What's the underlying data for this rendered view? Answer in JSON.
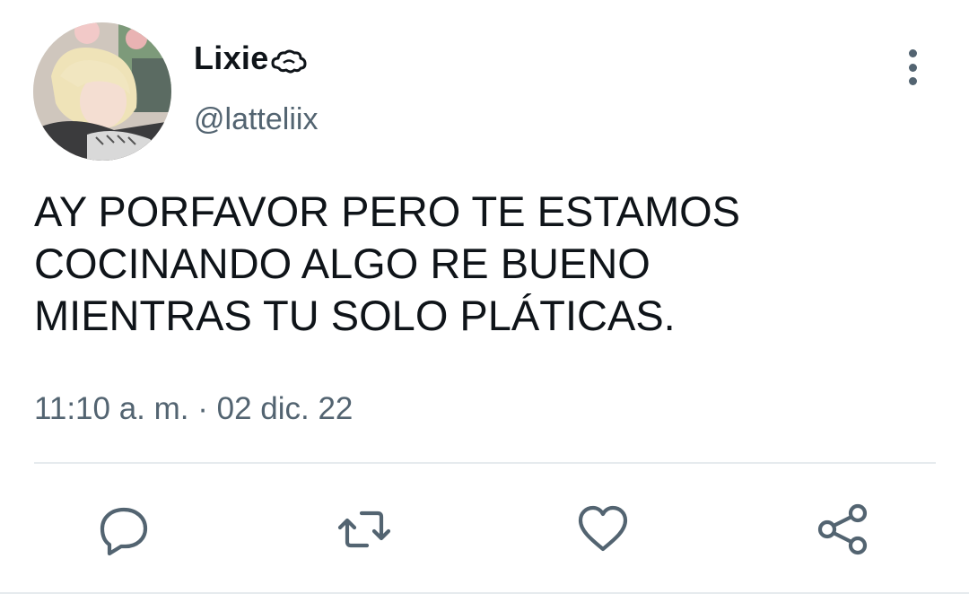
{
  "user": {
    "display_name": "Lixie",
    "display_name_emoji": "cloud-emoji-icon",
    "handle": "@latteliix",
    "avatar": "user-avatar-photo"
  },
  "tweet": {
    "lines": [
      "AY PORFAVOR PERO TE ESTAMOS",
      "COCINANDO ALGO RE BUENO",
      "MIENTRAS TU SOLO PLÁTICAS."
    ],
    "timestamp": "11:10 a. m. · 02 dic. 22"
  },
  "actions": {
    "icons": [
      "reply-icon",
      "retweet-icon",
      "like-icon",
      "share-icon"
    ],
    "icon_color": "#536471"
  },
  "colors": {
    "text_primary": "#0f1419",
    "text_secondary": "#536471",
    "divider": "#e6ebee"
  }
}
